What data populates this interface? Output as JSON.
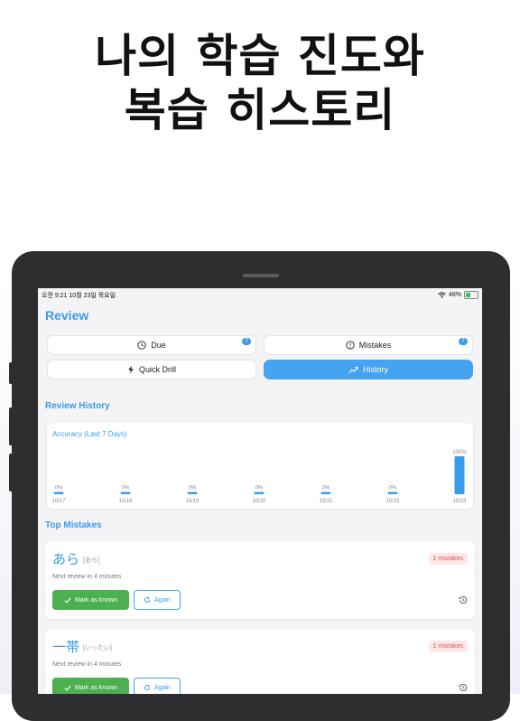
{
  "headline": {
    "line1": "나의 학습 진도와",
    "line2": "복습 히스토리"
  },
  "status_bar": {
    "time_date": "오전 9:21  10월 23일 목요일",
    "battery": "48%"
  },
  "screen": {
    "title": "Review",
    "tabs": [
      {
        "label": "Due",
        "icon": "clock-icon",
        "badge": "7",
        "active": false
      },
      {
        "label": "Mistakes",
        "icon": "alert-circle-icon",
        "badge": "7",
        "active": false
      },
      {
        "label": "Quick Drill",
        "icon": "bolt-icon",
        "active": false
      },
      {
        "label": "History",
        "icon": "trend-icon",
        "active": true
      }
    ],
    "history_title": "Review History",
    "top_mistakes_title": "Top Mistakes"
  },
  "chart_data": {
    "type": "bar",
    "title": "Accuracy (Last 7 Days)",
    "categories": [
      "10/17",
      "10/18",
      "10/19",
      "10/20",
      "10/21",
      "10/22",
      "10/23"
    ],
    "values": [
      0,
      0,
      0,
      0,
      0,
      0,
      100
    ],
    "value_labels": [
      "0%",
      "0%",
      "0%",
      "0%",
      "0%",
      "0%",
      "100%"
    ],
    "ylim": [
      0,
      100
    ],
    "grid": false,
    "colors": {
      "bar": "#3a9be8"
    }
  },
  "mistakes": [
    {
      "word": "あら",
      "reading": "[あら]",
      "badge": "1 mistakes",
      "next_review": "Next review in 4 minutes",
      "known_label": "Mark as known",
      "again_label": "Again"
    },
    {
      "word": "一帯",
      "reading": "[いったい]",
      "badge": "1 mistakes",
      "next_review": "Next review in 4 minutes",
      "known_label": "Mark as known",
      "again_label": "Again"
    }
  ],
  "colors": {
    "accent": "#3a9be8",
    "success": "#4caf50",
    "danger": "#d9534f"
  }
}
